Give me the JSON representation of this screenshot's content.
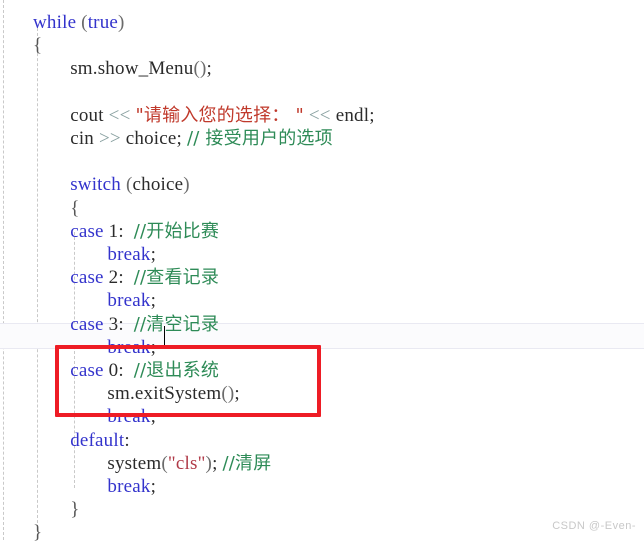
{
  "editor": {
    "language": "cpp",
    "caret_line_index": 11,
    "colors": {
      "keyword": "#3333cc",
      "string": "#b03a48",
      "comment": "#2e8b57",
      "operator": "#88a0a0",
      "plain": "#2b2b2b",
      "annotation_box": "#ee1c25",
      "current_line_bg": "#fbfbfd",
      "indent_guide": "#c9c9c9",
      "background": "#ffffff"
    },
    "annotation": {
      "shape": "rectangle",
      "color": "#ee1c25",
      "covers_lines": [
        "case 0:  //退出系统",
        "sm.exitSystem();",
        "break;"
      ]
    },
    "lines": [
      {
        "indent": 0,
        "tokens": [
          {
            "t": "while",
            "c": "kw"
          },
          {
            "t": " ",
            "c": "plain"
          },
          {
            "t": "(",
            "c": "punct"
          },
          {
            "t": "true",
            "c": "kw"
          },
          {
            "t": ")",
            "c": "punct"
          }
        ]
      },
      {
        "indent": 0,
        "tokens": [
          {
            "t": "{",
            "c": "brace"
          }
        ]
      },
      {
        "indent": 2,
        "tokens": [
          {
            "t": "sm.show_Menu",
            "c": "plain"
          },
          {
            "t": "()",
            "c": "punct"
          },
          {
            "t": ";",
            "c": "plain"
          }
        ]
      },
      {
        "indent": 0,
        "tokens": []
      },
      {
        "indent": 2,
        "tokens": [
          {
            "t": "cout",
            "c": "plain"
          },
          {
            "t": " ",
            "c": "plain"
          },
          {
            "t": "<<",
            "c": "op"
          },
          {
            "t": " ",
            "c": "plain"
          },
          {
            "t": "\"请输入您的选择： \"",
            "c": "strcn"
          },
          {
            "t": " ",
            "c": "plain"
          },
          {
            "t": "<<",
            "c": "op"
          },
          {
            "t": " ",
            "c": "plain"
          },
          {
            "t": "endl",
            "c": "plain"
          },
          {
            "t": ";",
            "c": "plain"
          }
        ]
      },
      {
        "indent": 2,
        "tokens": [
          {
            "t": "cin",
            "c": "plain"
          },
          {
            "t": " ",
            "c": "plain"
          },
          {
            "t": ">>",
            "c": "op"
          },
          {
            "t": " ",
            "c": "plain"
          },
          {
            "t": "choice",
            "c": "plain"
          },
          {
            "t": ";",
            "c": "plain"
          },
          {
            "t": " ",
            "c": "plain"
          },
          {
            "t": "// 接受用户的选项",
            "c": "comment"
          }
        ]
      },
      {
        "indent": 0,
        "tokens": []
      },
      {
        "indent": 2,
        "tokens": [
          {
            "t": "switch",
            "c": "kw"
          },
          {
            "t": " ",
            "c": "plain"
          },
          {
            "t": "(",
            "c": "punct"
          },
          {
            "t": "choice",
            "c": "plain"
          },
          {
            "t": ")",
            "c": "punct"
          }
        ]
      },
      {
        "indent": 2,
        "tokens": [
          {
            "t": "{",
            "c": "brace"
          }
        ]
      },
      {
        "indent": 2,
        "tokens": [
          {
            "t": "case",
            "c": "kw"
          },
          {
            "t": " 1:  ",
            "c": "plain"
          },
          {
            "t": "//开始比赛",
            "c": "comment"
          }
        ]
      },
      {
        "indent": 4,
        "tokens": [
          {
            "t": "break",
            "c": "kw"
          },
          {
            "t": ";",
            "c": "plain"
          }
        ]
      },
      {
        "indent": 2,
        "tokens": [
          {
            "t": "case",
            "c": "kw"
          },
          {
            "t": " 2:  ",
            "c": "plain"
          },
          {
            "t": "//查看记录",
            "c": "comment"
          }
        ]
      },
      {
        "indent": 4,
        "tokens": [
          {
            "t": "break",
            "c": "kw"
          },
          {
            "t": ";",
            "c": "plain"
          }
        ]
      },
      {
        "indent": 2,
        "tokens": [
          {
            "t": "case",
            "c": "kw"
          },
          {
            "t": " 3:  ",
            "c": "plain"
          },
          {
            "t": "//清空记录",
            "c": "comment"
          }
        ]
      },
      {
        "indent": 4,
        "tokens": [
          {
            "t": "break",
            "c": "kw"
          },
          {
            "t": ";",
            "c": "plain"
          }
        ]
      },
      {
        "indent": 2,
        "tokens": [
          {
            "t": "case",
            "c": "kw"
          },
          {
            "t": " 0:  ",
            "c": "plain"
          },
          {
            "t": "//退出系统",
            "c": "comment"
          }
        ]
      },
      {
        "indent": 4,
        "tokens": [
          {
            "t": "sm.exitSystem",
            "c": "plain"
          },
          {
            "t": "()",
            "c": "punct"
          },
          {
            "t": ";",
            "c": "plain"
          }
        ]
      },
      {
        "indent": 4,
        "tokens": [
          {
            "t": "break",
            "c": "kw"
          },
          {
            "t": ";",
            "c": "plain"
          }
        ]
      },
      {
        "indent": 2,
        "tokens": [
          {
            "t": "default",
            "c": "kw"
          },
          {
            "t": ":",
            "c": "plain"
          }
        ]
      },
      {
        "indent": 4,
        "tokens": [
          {
            "t": "system",
            "c": "plain"
          },
          {
            "t": "(",
            "c": "punct"
          },
          {
            "t": "\"cls\"",
            "c": "str"
          },
          {
            "t": ")",
            "c": "punct"
          },
          {
            "t": "; ",
            "c": "plain"
          },
          {
            "t": "//清屏",
            "c": "comment"
          }
        ]
      },
      {
        "indent": 4,
        "tokens": [
          {
            "t": "break",
            "c": "kw"
          },
          {
            "t": ";",
            "c": "plain"
          }
        ]
      },
      {
        "indent": 2,
        "tokens": [
          {
            "t": "}",
            "c": "brace"
          }
        ]
      },
      {
        "indent": 0,
        "tokens": [
          {
            "t": "}",
            "c": "brace"
          }
        ]
      }
    ]
  },
  "watermark": {
    "text": "CSDN @-Even-"
  }
}
